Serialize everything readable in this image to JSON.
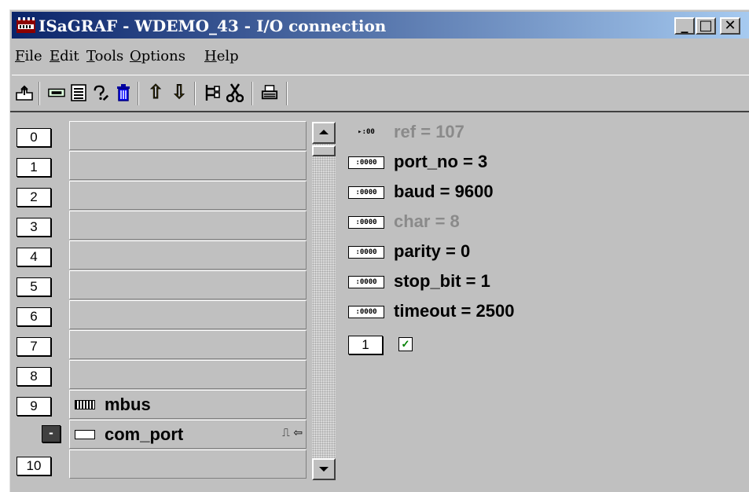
{
  "window": {
    "app_name": "ISaGRAF",
    "title": "ISaGRAF - WDEMO_43 - I/O connection"
  },
  "title_buttons": {
    "minimize": "_",
    "maximize": "□",
    "close": "✕"
  },
  "menu": [
    {
      "label": "File",
      "mnemonic": "F",
      "rest": "ile"
    },
    {
      "label": "Edit",
      "mnemonic": "E",
      "rest": "dit"
    },
    {
      "label": "Tools",
      "mnemonic": "T",
      "rest": "ools"
    },
    {
      "label": "Options",
      "mnemonic": "O",
      "rest": "ptions"
    },
    {
      "label": "Help",
      "mnemonic": "H",
      "rest": "elp"
    }
  ],
  "toolbar": {
    "icons": [
      "open-icon",
      "board-icon",
      "list-icon",
      "question-icon",
      "delete-icon",
      "up-arrow-icon",
      "down-arrow-icon",
      "hierarchy-icon",
      "cut-icon",
      "print-icon"
    ],
    "glyphs": {
      "up": "⇧",
      "down": "⇩"
    }
  },
  "slots": [
    {
      "number": "0",
      "label": "",
      "icon": ""
    },
    {
      "number": "1",
      "label": "",
      "icon": ""
    },
    {
      "number": "2",
      "label": "",
      "icon": ""
    },
    {
      "number": "3",
      "label": "",
      "icon": ""
    },
    {
      "number": "4",
      "label": "",
      "icon": ""
    },
    {
      "number": "5",
      "label": "",
      "icon": ""
    },
    {
      "number": "6",
      "label": "",
      "icon": ""
    },
    {
      "number": "7",
      "label": "",
      "icon": ""
    },
    {
      "number": "8",
      "label": "",
      "icon": ""
    },
    {
      "number": "9",
      "label": "mbus",
      "icon": "rack-icon"
    },
    {
      "number": "-",
      "label": "com_port",
      "icon": "port-icon",
      "selected": true
    },
    {
      "number": "10",
      "label": "",
      "icon": ""
    }
  ],
  "slot_suffix_glyphs": "⎍ ⇦",
  "parameters": [
    {
      "icon_text": "▸:00",
      "text": "ref = 107",
      "enabled": false
    },
    {
      "icon_text": ":0000",
      "text": "port_no = 3",
      "enabled": true
    },
    {
      "icon_text": ":0000",
      "text": "baud = 9600",
      "enabled": true
    },
    {
      "icon_text": ":0000",
      "text": "char = 8",
      "enabled": false
    },
    {
      "icon_text": ":0000",
      "text": "parity = 0",
      "enabled": true
    },
    {
      "icon_text": ":0000",
      "text": "stop_bit = 1",
      "enabled": true
    },
    {
      "icon_text": ":0000",
      "text": "timeout = 2500",
      "enabled": true
    }
  ],
  "channel": {
    "number": "1",
    "status_glyph": "✓"
  },
  "colors": {
    "title_start": "#0a246a",
    "title_end": "#a6caf0",
    "face": "#c0c0c0",
    "disabled_text": "#8a8a8a"
  }
}
